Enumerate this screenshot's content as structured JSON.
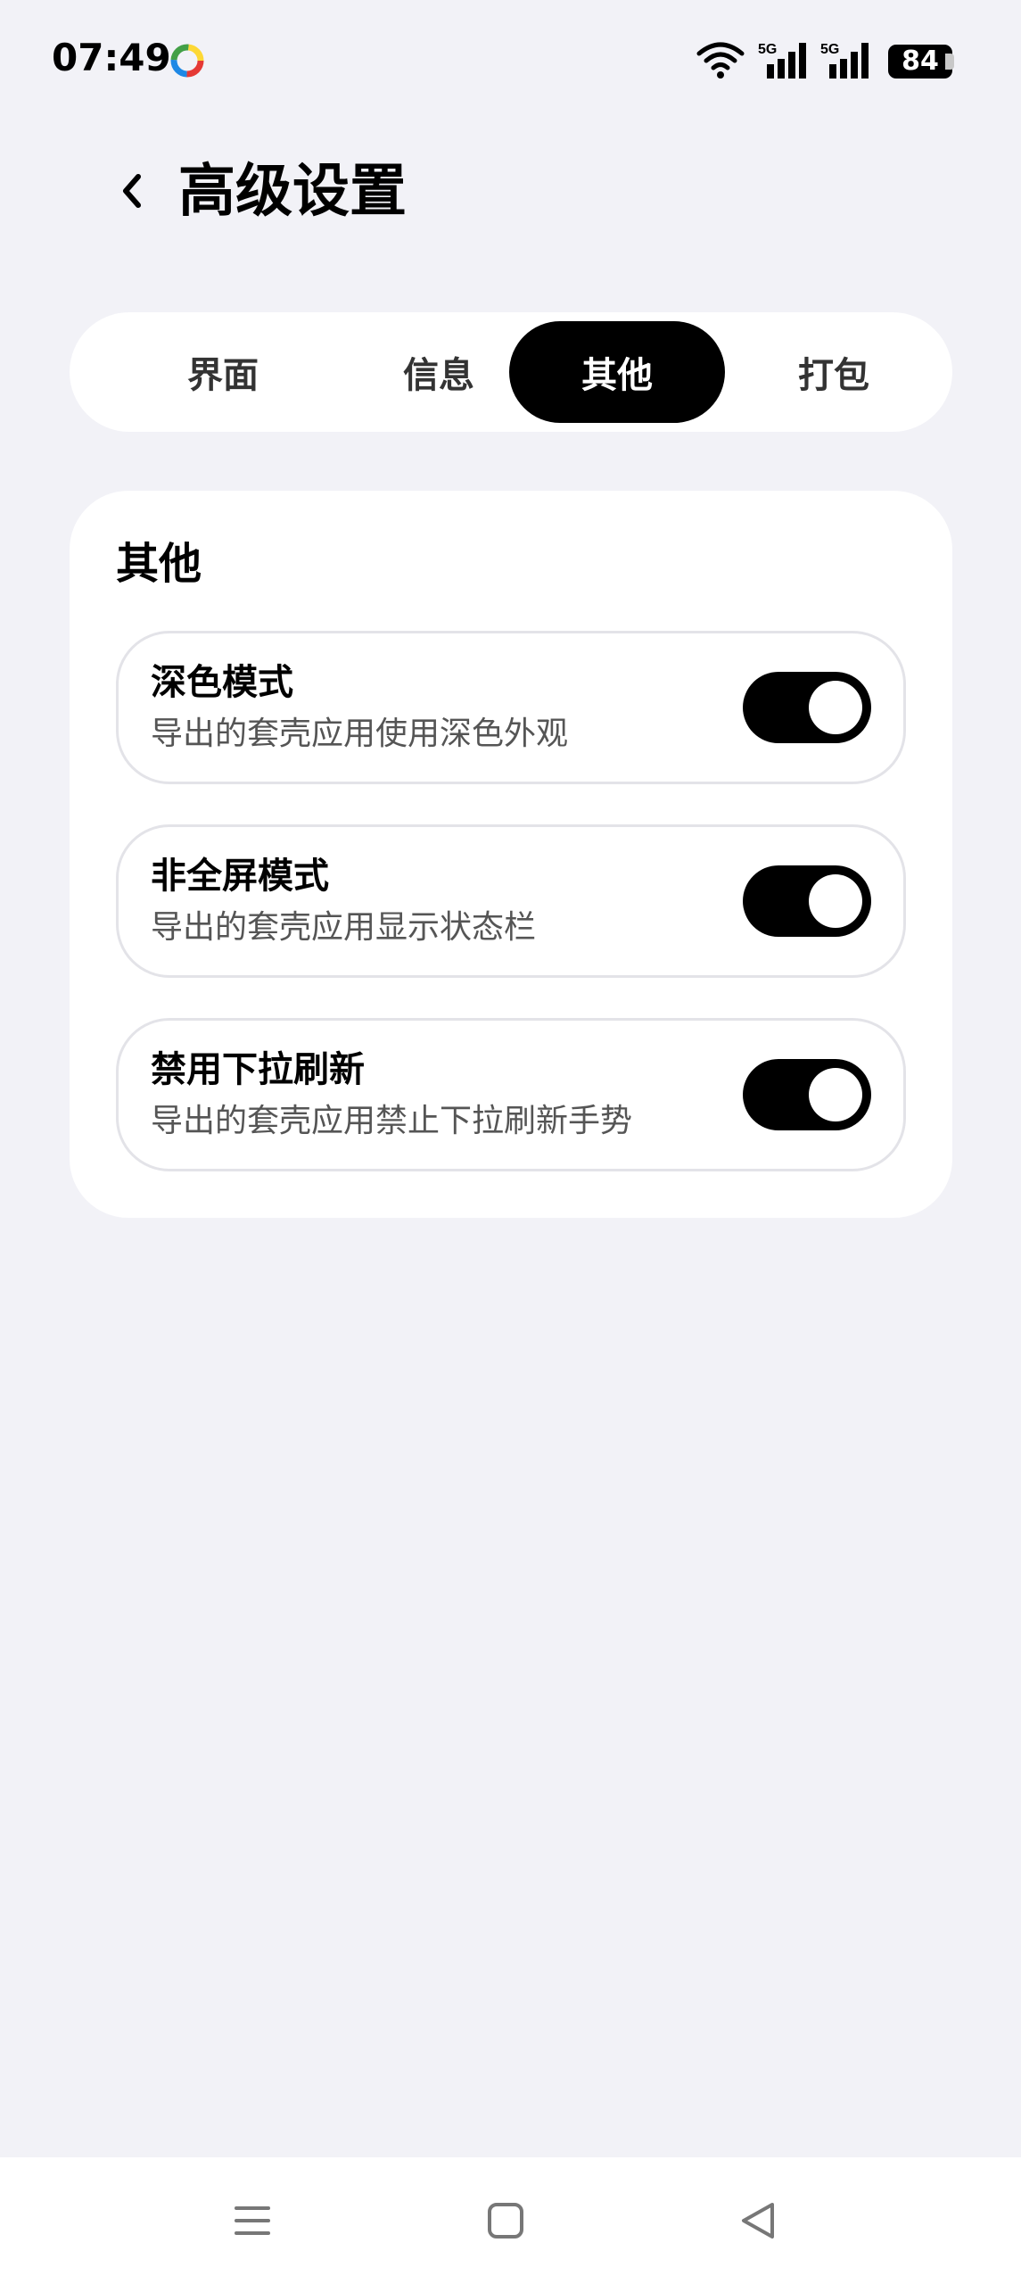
{
  "status_bar": {
    "time": "07:49",
    "network_1": "5G",
    "network_2": "5G",
    "battery": "84",
    "icons": [
      "app-indicator-icon",
      "wifi-icon",
      "signal-5g-icon",
      "signal-5g-icon",
      "battery-icon"
    ]
  },
  "header": {
    "back_icon": "chevron-left-icon",
    "title": "高级设置"
  },
  "tabs": [
    {
      "label": "界面",
      "active": false
    },
    {
      "label": "信息",
      "active": false
    },
    {
      "label": "其他",
      "active": true
    },
    {
      "label": "打包",
      "active": false
    }
  ],
  "section": {
    "title": "其他",
    "items": [
      {
        "title": "深色模式",
        "subtitle": "导出的套壳应用使用深色外观",
        "enabled": true
      },
      {
        "title": "非全屏模式",
        "subtitle": "导出的套壳应用显示状态栏",
        "enabled": true
      },
      {
        "title": "禁用下拉刷新",
        "subtitle": "导出的套壳应用禁止下拉刷新手势",
        "enabled": true
      }
    ]
  },
  "nav_bar": {
    "icons": [
      "menu-icon",
      "home-icon",
      "back-triangle-icon"
    ]
  },
  "colors": {
    "background": "#f2f2f7",
    "card": "#ffffff",
    "accent": "#000000",
    "toggle_on": "#000000"
  }
}
